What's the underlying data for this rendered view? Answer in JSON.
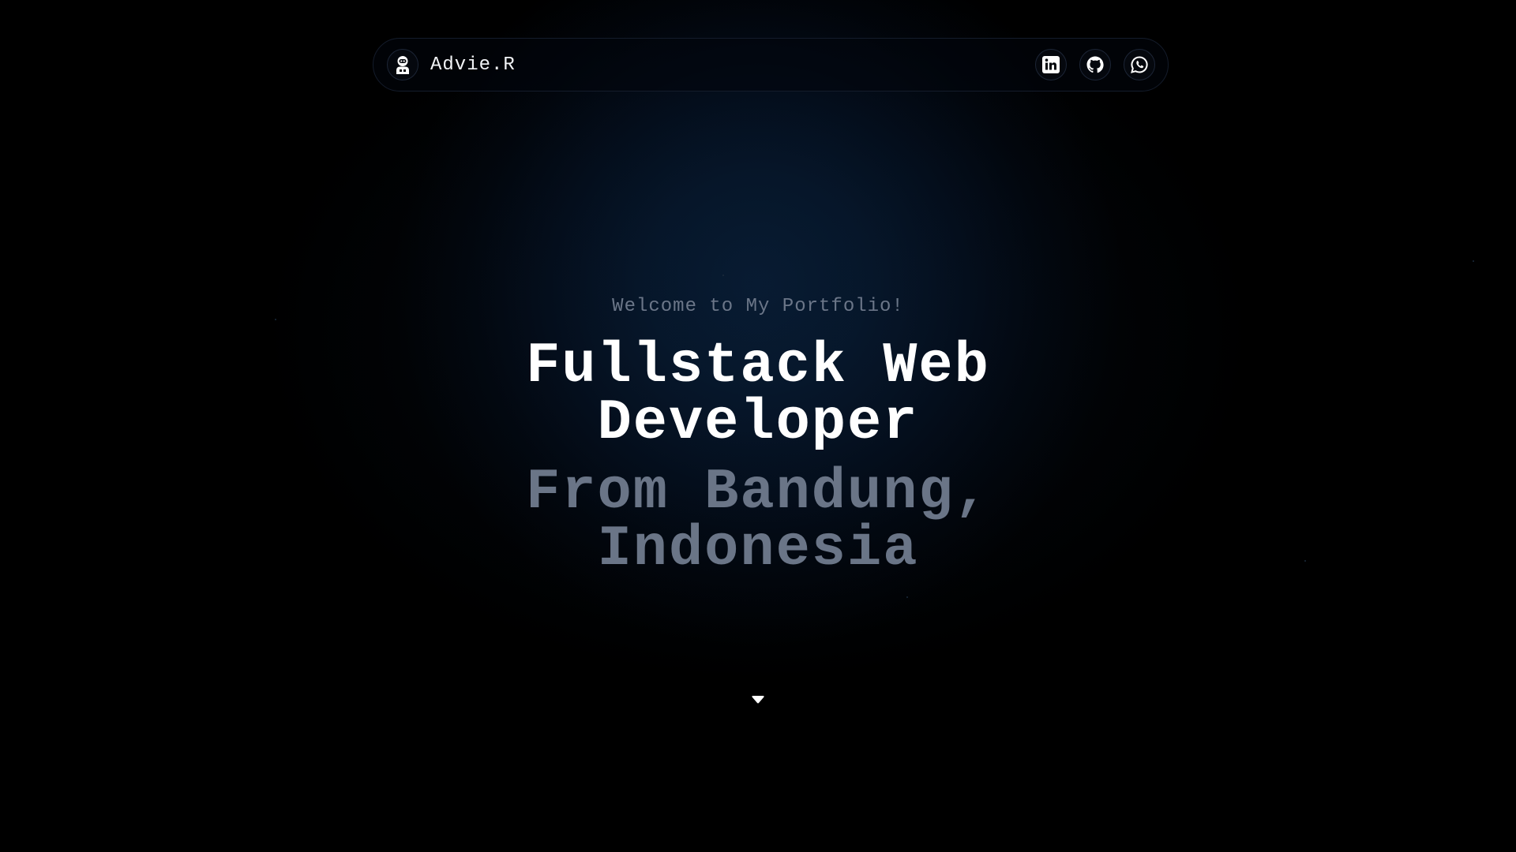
{
  "header": {
    "brand_name": "Advie.R",
    "avatar_icon": "astronaut-icon",
    "socials": [
      {
        "name": "LinkedIn",
        "icon": "linkedin-icon"
      },
      {
        "name": "GitHub",
        "icon": "github-icon"
      },
      {
        "name": "WhatsApp",
        "icon": "whatsapp-icon"
      }
    ]
  },
  "hero": {
    "welcome": "Welcome to My Portfolio!",
    "headline_line1": "Fullstack Web",
    "headline_line2": "Developer",
    "subline_line1": "From Bandung,",
    "subline_line2": "Indonesia",
    "scroll_icon": "caret-down-icon"
  },
  "colors": {
    "background": "#000000",
    "glow": "#071a30",
    "primary_text": "#ffffff",
    "muted_text": "#6a7587"
  }
}
